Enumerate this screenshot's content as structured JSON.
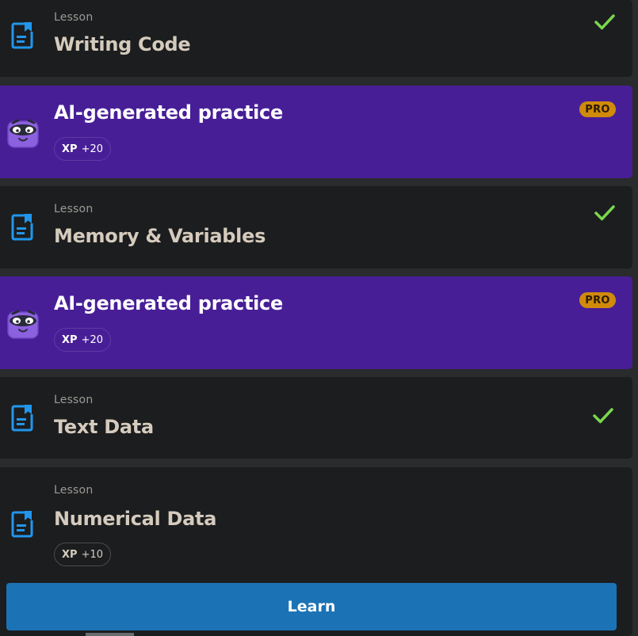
{
  "items": [
    {
      "kind": "lesson",
      "kicker": "Lesson",
      "title": "Writing Code",
      "completed": true
    },
    {
      "kind": "practice",
      "title": "AI-generated practice",
      "badge": "PRO",
      "xp_label": "XP",
      "xp_value": "+20"
    },
    {
      "kind": "lesson",
      "kicker": "Lesson",
      "title": "Memory & Variables",
      "completed": true
    },
    {
      "kind": "practice",
      "title": "AI-generated practice",
      "badge": "PRO",
      "xp_label": "XP",
      "xp_value": "+20"
    },
    {
      "kind": "lesson",
      "kicker": "Lesson",
      "title": "Text Data",
      "completed": true
    },
    {
      "kind": "lesson",
      "kicker": "Lesson",
      "title": "Numerical Data",
      "completed": false,
      "xp_label": "XP",
      "xp_value": "+10"
    }
  ],
  "learn_button": {
    "label": "Learn"
  },
  "colors": {
    "background": "#2a2b2d",
    "card": "#1c1d1f",
    "practice_card": "#481e97",
    "accent_blue": "#1b73b5",
    "doc_icon": "#2196ec",
    "check": "#7ad74e",
    "pro_badge": "#d08b0b"
  },
  "icons": {
    "lesson": "document-bookmark-icon",
    "practice": "mascot-robot-icon",
    "completed": "checkmark-icon"
  }
}
